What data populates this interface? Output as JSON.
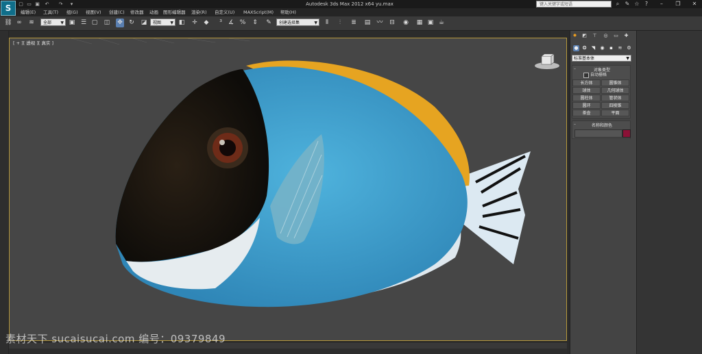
{
  "window": {
    "title": "Autodesk 3ds Max  2012 x64        yu.max",
    "search_placeholder": "键入关键字或短语"
  },
  "menu": [
    "编辑(E)",
    "工具(T)",
    "组(G)",
    "视图(V)",
    "创建(C)",
    "修改器",
    "动画",
    "图形编辑器",
    "渲染(R)",
    "自定义(U)",
    "MAXScript(M)",
    "帮助(H)"
  ],
  "toolbar": {
    "selection_filter": "全部",
    "reference_coord": "视图",
    "named_selection": "创建选择集"
  },
  "viewport": {
    "label": "[ + ][ 透视 ][ 真实 ]",
    "scene_image": "3d-fish-model"
  },
  "command_panel": {
    "category": "标准基本体",
    "object_type_title": "对象类型",
    "autogrid_label": "自动栅格",
    "autogrid_checked": false,
    "buttons": [
      "长方体",
      "圆锥体",
      "球体",
      "几何球体",
      "圆柱体",
      "管状体",
      "圆环",
      "四棱锥",
      "茶壶",
      "平面"
    ],
    "name_color_title": "名称和颜色",
    "object_color": "#8b1136"
  },
  "watermark": "素材天下 sucaisucai.com   编号：09379849",
  "colors": {
    "viewport_border": "#b89a3c",
    "active_tool": "#5a7fb0"
  }
}
